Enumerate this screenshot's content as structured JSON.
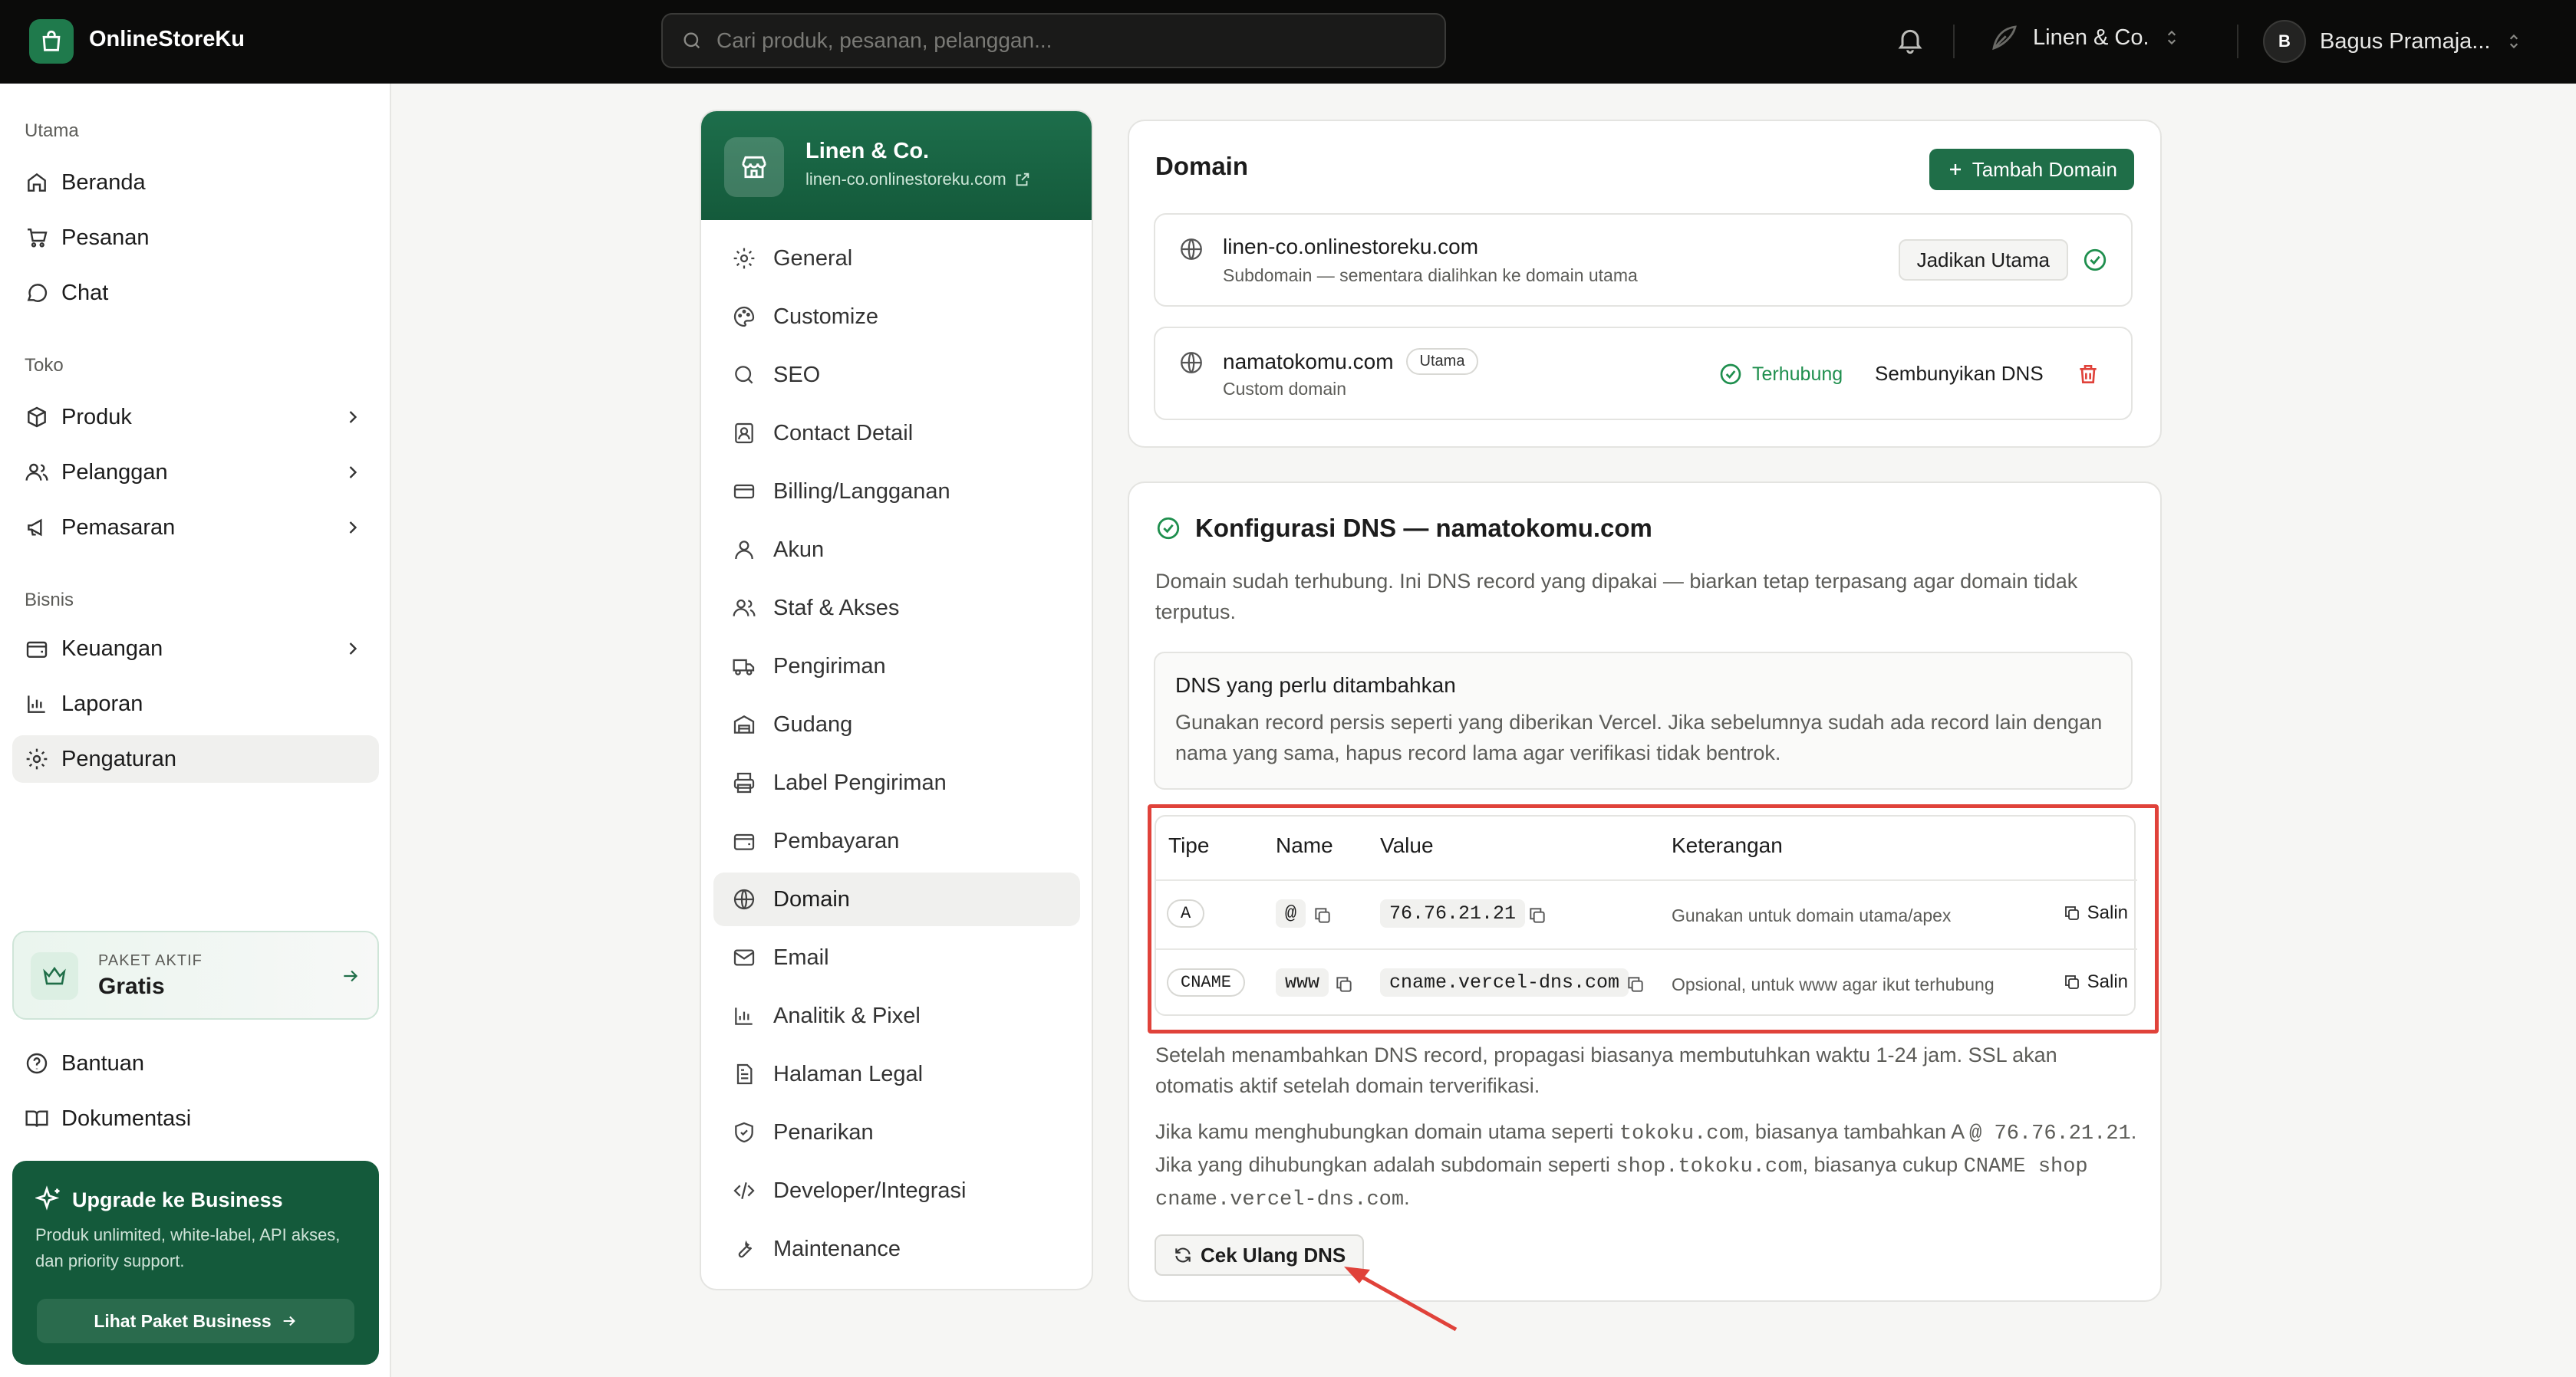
{
  "app": {
    "name": "OnlineStoreKu"
  },
  "search": {
    "placeholder": "Cari produk, pesanan, pelanggan..."
  },
  "store_switcher": {
    "label": "Linen & Co."
  },
  "user": {
    "initial": "B",
    "name": "Bagus Pramaja..."
  },
  "sidebar": {
    "sections": [
      {
        "label": "Utama"
      },
      {
        "label": "Toko"
      },
      {
        "label": "Bisnis"
      }
    ],
    "items": [
      {
        "label": "Beranda",
        "icon": "home-icon"
      },
      {
        "label": "Pesanan",
        "icon": "cart-icon"
      },
      {
        "label": "Chat",
        "icon": "chat-icon"
      },
      {
        "label": "Produk",
        "icon": "box-icon"
      },
      {
        "label": "Pelanggan",
        "icon": "users-icon"
      },
      {
        "label": "Pemasaran",
        "icon": "megaphone-icon"
      },
      {
        "label": "Keuangan",
        "icon": "wallet-icon"
      },
      {
        "label": "Laporan",
        "icon": "chart-icon"
      },
      {
        "label": "Pengaturan",
        "icon": "gear-icon"
      }
    ],
    "paket": {
      "label": "PAKET AKTIF",
      "value": "Gratis"
    },
    "help": [
      {
        "label": "Bantuan",
        "icon": "help-icon"
      },
      {
        "label": "Dokumentasi",
        "icon": "book-icon"
      }
    ],
    "upgrade": {
      "title": "Upgrade ke Business",
      "desc": "Produk unlimited, white-label, API akses, dan priority support.",
      "button": "Lihat Paket Business"
    }
  },
  "settings": {
    "store_name": "Linen & Co.",
    "store_url": "linen-co.onlinestoreku.com",
    "items": [
      {
        "label": "General",
        "icon": "gear-icon"
      },
      {
        "label": "Customize",
        "icon": "palette-icon"
      },
      {
        "label": "SEO",
        "icon": "search-icon"
      },
      {
        "label": "Contact Detail",
        "icon": "contact-icon"
      },
      {
        "label": "Billing/Langganan",
        "icon": "card-icon"
      },
      {
        "label": "Akun",
        "icon": "user-icon"
      },
      {
        "label": "Staf & Akses",
        "icon": "users-icon"
      },
      {
        "label": "Pengiriman",
        "icon": "truck-icon"
      },
      {
        "label": "Gudang",
        "icon": "warehouse-icon"
      },
      {
        "label": "Label Pengiriman",
        "icon": "printer-icon"
      },
      {
        "label": "Pembayaran",
        "icon": "wallet-icon"
      },
      {
        "label": "Domain",
        "icon": "globe-icon"
      },
      {
        "label": "Email",
        "icon": "mail-icon"
      },
      {
        "label": "Analitik & Pixel",
        "icon": "chart-icon"
      },
      {
        "label": "Halaman Legal",
        "icon": "file-icon"
      },
      {
        "label": "Penarikan",
        "icon": "shield-icon"
      },
      {
        "label": "Developer/Integrasi",
        "icon": "code-icon"
      },
      {
        "label": "Maintenance",
        "icon": "wrench-icon"
      }
    ]
  },
  "domain": {
    "title": "Domain",
    "add_button": "Tambah Domain",
    "rows": [
      {
        "name": "linen-co.onlinestoreku.com",
        "sub": "Subdomain — sementara dialihkan ke domain utama",
        "action": "Jadikan Utama"
      },
      {
        "name": "namatokomu.com",
        "badge": "Utama",
        "sub": "Custom domain",
        "status": "Terhubung",
        "action": "Sembunyikan DNS"
      }
    ]
  },
  "dns": {
    "title": "Konfigurasi DNS — namatokomu.com",
    "intro": "Domain sudah terhubung. Ini DNS record yang dipakai — biarkan tetap terpasang agar domain tidak terputus.",
    "box_title": "DNS yang perlu ditambahkan",
    "box_body": "Gunakan record persis seperti yang diberikan Vercel. Jika sebelumnya sudah ada record lain dengan nama yang sama, hapus record lama agar verifikasi tidak bentrok.",
    "headers": [
      "Tipe",
      "Name",
      "Value",
      "Keterangan"
    ],
    "records": [
      {
        "type": "A",
        "name": "@",
        "value": "76.76.21.21",
        "note": "Gunakan untuk domain utama/apex",
        "copy": "Salin"
      },
      {
        "type": "CNAME",
        "name": "www",
        "value": "cname.vercel-dns.com",
        "note": "Opsional, untuk www agar ikut terhubung",
        "copy": "Salin"
      }
    ],
    "after": "Setelah menambahkan DNS record, propagasi biasanya membutuhkan waktu 1-24 jam. SSL akan otomatis aktif setelah domain terverifikasi.",
    "hint": {
      "t1": "Jika kamu menghubungkan domain utama seperti ",
      "c1": "tokoku.com",
      "t2": ", biasanya tambahkan A ",
      "c2": "@ 76.76.21.21",
      "t3": ". Jika yang dihubungkan adalah subdomain seperti ",
      "c3": "shop.tokoku.com",
      "t4": ", biasanya cukup ",
      "c4": "CNAME shop cname.vercel-dns.com",
      "t5": "."
    },
    "recheck": "Cek Ulang DNS"
  },
  "colors": {
    "brand": "#1f6e48",
    "highlight": "#e0423a",
    "success": "#1f8f4e",
    "danger": "#e0423a"
  }
}
